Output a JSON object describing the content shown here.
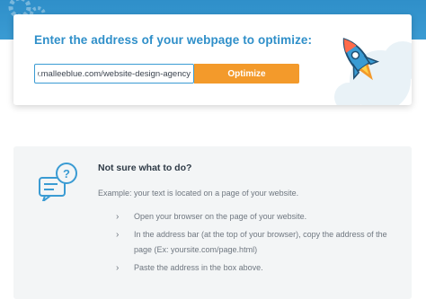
{
  "optimizer": {
    "title": "Enter the address of your webpage to optimize:",
    "url_value": "https://www.malleeblue.com/website-design-agency/",
    "button_label": "Optimize"
  },
  "help": {
    "title": "Not sure what to do?",
    "example": "Example: your text is located on a page of your website.",
    "steps": [
      {
        "text": "Open your browser on the page of your website."
      },
      {
        "text": "In the address bar (at the top of your browser), copy the address of the page (Ex: yoursite.com/page.html)"
      },
      {
        "text": "Paste the address in the box above."
      }
    ]
  },
  "colors": {
    "brand_blue": "#2f8fc9",
    "accent_orange": "#f39a2b",
    "panel_gray": "#f3f5f6"
  },
  "icons": {
    "gear": "gear-icon",
    "rocket": "rocket-icon",
    "chat": "chat-question-icon",
    "chevron": "chevron-right-icon"
  }
}
